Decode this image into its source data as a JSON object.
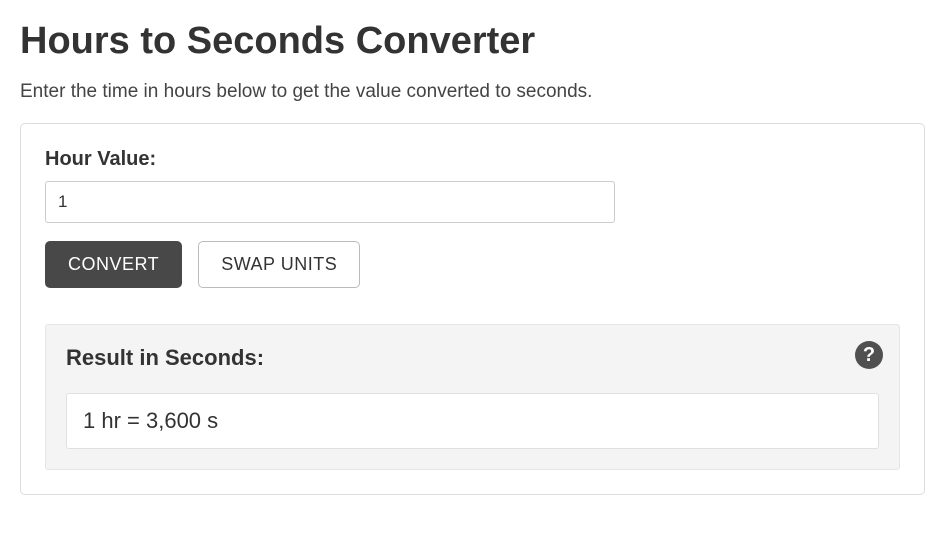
{
  "page": {
    "title": "Hours to Seconds Converter",
    "subtitle": "Enter the time in hours below to get the value converted to seconds."
  },
  "form": {
    "input_label": "Hour Value:",
    "input_value": "1",
    "convert_label": "CONVERT",
    "swap_label": "SWAP UNITS"
  },
  "result": {
    "label": "Result in Seconds:",
    "value": "1 hr = 3,600 s",
    "help_symbol": "?"
  }
}
